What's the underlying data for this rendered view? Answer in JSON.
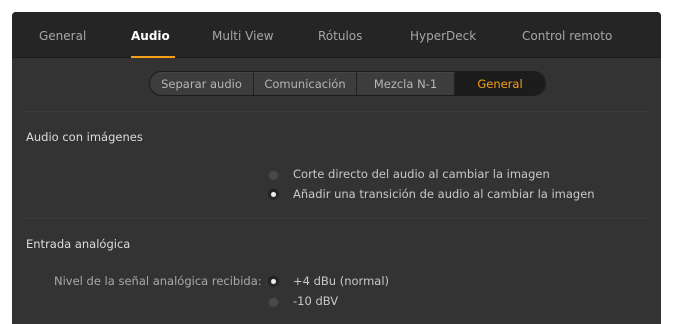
{
  "tabs": [
    {
      "label": "General"
    },
    {
      "label": "Audio"
    },
    {
      "label": "Multi View"
    },
    {
      "label": "Rótulos"
    },
    {
      "label": "HyperDeck"
    },
    {
      "label": "Control remoto"
    }
  ],
  "active_tab": "Audio",
  "subtabs": [
    {
      "label": "Separar audio"
    },
    {
      "label": "Comunicación"
    },
    {
      "label": "Mezcla N-1"
    },
    {
      "label": "General"
    }
  ],
  "active_subtab": "General",
  "accent_color": "#f6a01a",
  "audio_follow_video": {
    "title": "Audio con imágenes",
    "options": [
      {
        "label": "Corte directo del audio al cambiar la imagen",
        "selected": false
      },
      {
        "label": "Añadir una transición de audio al cambiar la imagen",
        "selected": true
      }
    ]
  },
  "analog_input": {
    "title": "Entrada analógica",
    "level_label": "Nivel de la señal analógica recibida:",
    "options": [
      {
        "label": "+4 dBu (normal)",
        "selected": true
      },
      {
        "label": "-10 dBV",
        "selected": false
      }
    ]
  }
}
